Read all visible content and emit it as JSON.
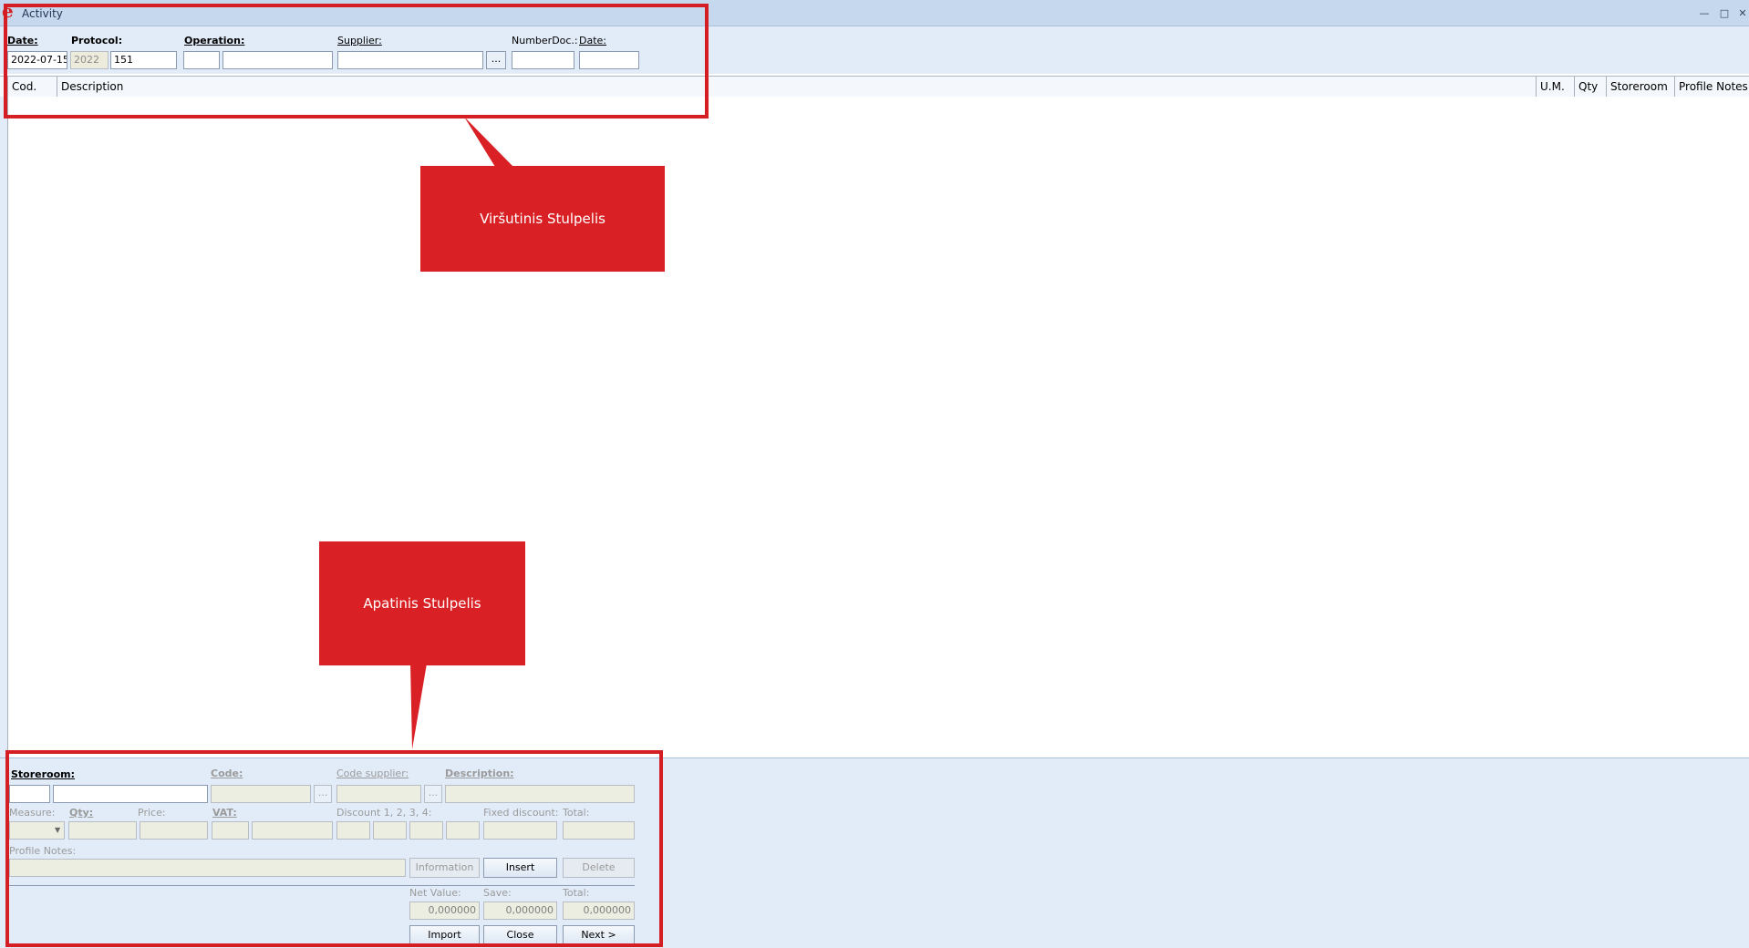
{
  "window": {
    "title": "Activity",
    "logo_glyph": "e",
    "controls": {
      "minimize": "—",
      "maximize": "□",
      "close": "✕"
    }
  },
  "header": {
    "date_label": "Date:",
    "date_value": "2022-07-15",
    "protocol_label": "Protocol:",
    "protocol_year": "2022",
    "protocol_number": "151",
    "operation_label": "Operation:",
    "operation_code": "",
    "operation_desc": "",
    "supplier_label": "Supplier:",
    "supplier_value": "",
    "supplier_lookup": "...",
    "number_doc_label": "NumberDoc.:",
    "number_doc_value": "",
    "doc_date_label": "Date:",
    "doc_date_value": ""
  },
  "grid": {
    "columns": [
      "Cod.",
      "Description",
      "U.M.",
      "Qty",
      "Storeroom",
      "Profile Notes"
    ]
  },
  "entry": {
    "storeroom_label": "Storeroom:",
    "storeroom_code": "",
    "storeroom_desc": "",
    "code_label": "Code:",
    "code_lookup": "...",
    "code_supplier_label": "Code supplier:",
    "code_supplier_lookup": "...",
    "description_label": "Description:",
    "measure_label": "Measure:",
    "qty_label": "Qty:",
    "price_label": "Price:",
    "vat_label": "VAT:",
    "discount_label": "Discount 1, 2, 3, 4:",
    "fixed_discount_label": "Fixed discount:",
    "total_label": "Total:",
    "profile_notes_label": "Profile Notes:",
    "buttons": {
      "information": "Information",
      "insert": "Insert",
      "delete": "Delete",
      "import": "Import",
      "close": "Close",
      "next": "Next >"
    },
    "net_value_label": "Net Value:",
    "save_label": "Save:",
    "summary_total_label": "Total:",
    "net_value": "0,000000",
    "save_value": "0,000000",
    "total_value": "0,000000"
  },
  "annotations": {
    "top_callout": "Viršutinis Stulpelis",
    "bottom_callout": "Apatinis Stulpelis",
    "color": "#d92125"
  }
}
